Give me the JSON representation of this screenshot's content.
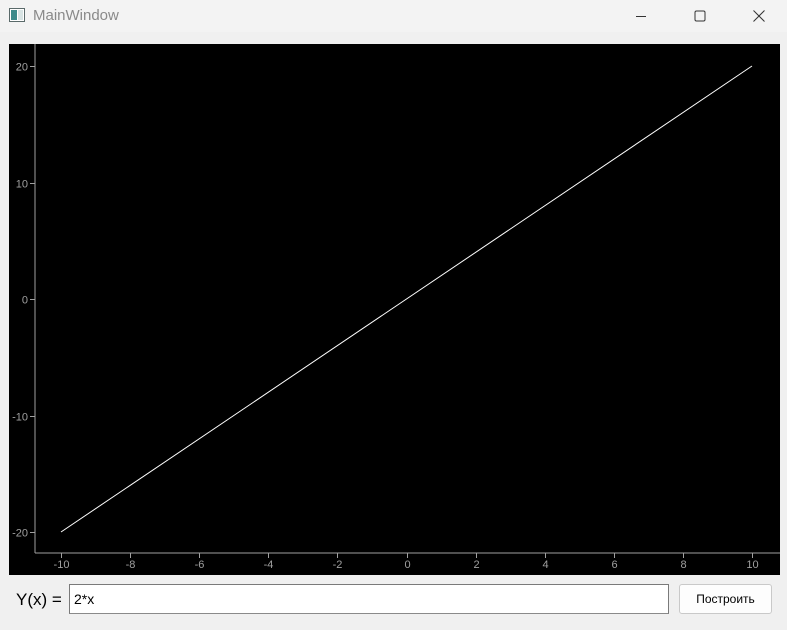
{
  "window": {
    "title": "MainWindow",
    "app_icon": "qt-window-icon",
    "controls": {
      "minimize_icon": "minimize-icon",
      "maximize_icon": "maximize-icon",
      "close_icon": "close-icon"
    }
  },
  "plot": {
    "background": "#000000",
    "line_color": "#ffffff",
    "axis_color": "#a0a0a0"
  },
  "chart_data": {
    "type": "line",
    "series": [
      {
        "x": [
          -10,
          10
        ],
        "values": [
          -20,
          20
        ]
      }
    ],
    "xlim": [
      -10,
      10
    ],
    "ylim": [
      -20,
      20
    ],
    "xticks": [
      -10,
      -8,
      -6,
      -4,
      -2,
      0,
      2,
      4,
      6,
      8,
      10
    ],
    "yticks": [
      -20,
      -10,
      0,
      10,
      20
    ],
    "grid": false,
    "title": "",
    "xlabel": "",
    "ylabel": ""
  },
  "form": {
    "label": "Y(x) =",
    "formula_value": "2*x",
    "button_label": "Построить"
  }
}
